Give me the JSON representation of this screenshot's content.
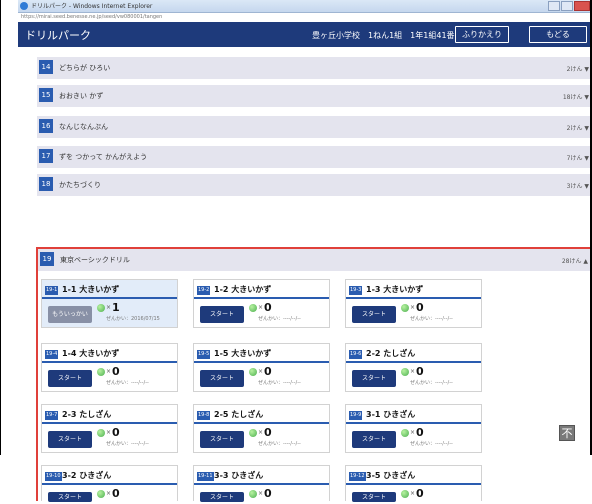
{
  "window": {
    "title": "ドリルパーク - Windows Internet Explorer",
    "url": "https://mirai.seed.benesse.ne.jp/seed/vw080001/tangen"
  },
  "header": {
    "brand": "ドリルパーク",
    "user_info": "豊ヶ丘小学校　1ねん1組　1年1組41番",
    "review_button": "ふりかえり",
    "back_button": "もどる"
  },
  "units": [
    {
      "num": "14",
      "label": "どちらが ひろい",
      "count": "2けん ▼"
    },
    {
      "num": "15",
      "label": "おおきい かず",
      "count": "18けん ▼"
    },
    {
      "num": "16",
      "label": "なんじなんぷん",
      "count": "2けん ▼"
    },
    {
      "num": "17",
      "label": "ずを つかって かんがえよう",
      "count": "7けん ▼"
    },
    {
      "num": "18",
      "label": "かたちづくり",
      "count": "3けん ▼"
    }
  ],
  "expanded": {
    "num": "19",
    "label": "東京ベーシックドリル",
    "count": "28けん ▲"
  },
  "cards": [
    {
      "tag": "19-1",
      "title": "1-1 大きいかず",
      "button": "もういっかい",
      "count": "1",
      "date": "ぜんかい：2016/07/15"
    },
    {
      "tag": "19-2",
      "title": "1-2 大きいかず",
      "button": "スタート",
      "count": "0",
      "date": "ぜんかい：----/--/--"
    },
    {
      "tag": "19-3",
      "title": "1-3 大きいかず",
      "button": "スタート",
      "count": "0",
      "date": "ぜんかい：----/--/--"
    },
    {
      "tag": "19-4",
      "title": "1-4 大きいかず",
      "button": "スタート",
      "count": "0",
      "date": "ぜんかい：----/--/--"
    },
    {
      "tag": "19-5",
      "title": "1-5 大きいかず",
      "button": "スタート",
      "count": "0",
      "date": "ぜんかい：----/--/--"
    },
    {
      "tag": "19-6",
      "title": "2-2 たしざん",
      "button": "スタート",
      "count": "0",
      "date": "ぜんかい：----/--/--"
    },
    {
      "tag": "19-7",
      "title": "2-3 たしざん",
      "button": "スタート",
      "count": "0",
      "date": "ぜんかい：----/--/--"
    },
    {
      "tag": "19-8",
      "title": "2-5 たしざん",
      "button": "スタート",
      "count": "0",
      "date": "ぜんかい：----/--/--"
    },
    {
      "tag": "19-9",
      "title": "3-1 ひきざん",
      "button": "スタート",
      "count": "0",
      "date": "ぜんかい：----/--/--"
    },
    {
      "tag": "19-10",
      "title": "3-2 ひきざん",
      "button": "スタート",
      "count": "0",
      "date": ""
    },
    {
      "tag": "19-11",
      "title": "3-3 ひきざん",
      "button": "スタート",
      "count": "0",
      "date": ""
    },
    {
      "tag": "19-12",
      "title": "3-5 ひきざん",
      "button": "スタート",
      "count": "0",
      "date": ""
    }
  ],
  "times_symbol": "×",
  "top_button": "不"
}
